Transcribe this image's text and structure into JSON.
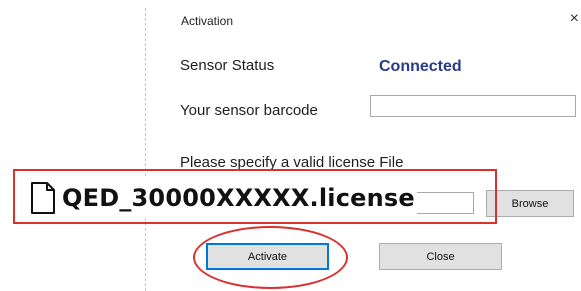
{
  "window": {
    "title": "Activation",
    "close_glyph": "×"
  },
  "sensor_status": {
    "label": "Sensor Status",
    "value": "Connected"
  },
  "barcode": {
    "label": "Your sensor barcode",
    "value": ""
  },
  "license": {
    "prompt": "Please specify a valid license File",
    "file_name": "QED_30000XXXXX.license",
    "file_icon": "file-icon"
  },
  "buttons": {
    "browse": "Browse",
    "activate": "Activate",
    "close": "Close"
  },
  "colors": {
    "status": "#2a3a8c",
    "highlight": "#d93030",
    "default_button_border": "#0078d7"
  }
}
